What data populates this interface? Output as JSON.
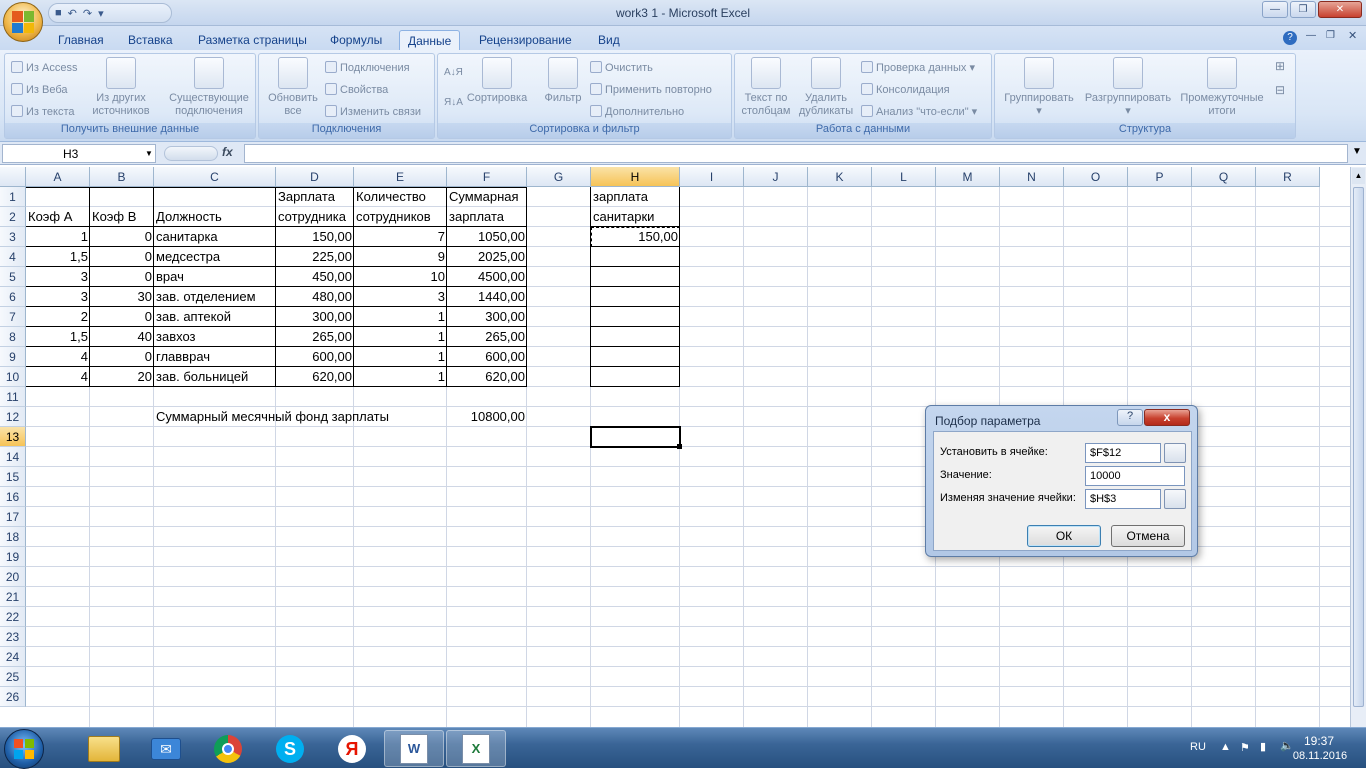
{
  "window": {
    "title": "work3 1 - Microsoft Excel"
  },
  "tabs": [
    "Главная",
    "Вставка",
    "Разметка страницы",
    "Формулы",
    "Данные",
    "Рецензирование",
    "Вид"
  ],
  "active_tab": "Данные",
  "ribbon": {
    "external": {
      "label": "Получить внешние данные",
      "access": "Из Access",
      "web": "Из Веба",
      "text": "Из текста",
      "other_1": "Из других",
      "other_2": "источников",
      "existing_1": "Существующие",
      "existing_2": "подключения"
    },
    "connections": {
      "label": "Подключения",
      "refresh_1": "Обновить",
      "refresh_2": "все",
      "conn": "Подключения",
      "props": "Свойства",
      "edit": "Изменить связи"
    },
    "sort": {
      "label": "Сортировка и фильтр",
      "sort": "Сортировка",
      "filter": "Фильтр",
      "clear": "Очистить",
      "reapply": "Применить повторно",
      "advanced": "Дополнительно"
    },
    "data_tools": {
      "label": "Работа с данными",
      "text_1": "Текст по",
      "text_2": "столбцам",
      "dup_1": "Удалить",
      "dup_2": "дубликаты",
      "validate": "Проверка данных",
      "consolidate": "Консолидация",
      "whatif": "Анализ \"что-если\""
    },
    "outline": {
      "label": "Структура",
      "group": "Группировать",
      "ungroup": "Разгруппировать",
      "sub_1": "Промежуточные",
      "sub_2": "итоги"
    }
  },
  "formula_bar": {
    "name_box": "H3",
    "fx": "fx",
    "formula": ""
  },
  "columns": [
    "A",
    "B",
    "C",
    "D",
    "E",
    "F",
    "G",
    "H",
    "I",
    "J",
    "K",
    "L",
    "M",
    "N",
    "O",
    "P",
    "Q",
    "R"
  ],
  "rows": [
    "1",
    "2",
    "3",
    "4",
    "5",
    "6",
    "7",
    "8",
    "9",
    "10",
    "11",
    "12",
    "13",
    "14",
    "15",
    "16",
    "17",
    "18",
    "19",
    "20",
    "21",
    "22",
    "23",
    "24",
    "25",
    "26"
  ],
  "headers": {
    "a": "Коэф А",
    "b": "Коэф В",
    "c": "Должность",
    "d1": "Зарплата",
    "d2": "сотрудника",
    "e1": "Количество",
    "e2": "сотрудников",
    "f1": "Суммарная",
    "f2": "зарплата",
    "h1": "зарплата",
    "h2": "санитарки"
  },
  "table": [
    [
      "1",
      "0",
      "санитарка",
      "150,00",
      "7",
      "1050,00"
    ],
    [
      "1,5",
      "0",
      "медсестра",
      "225,00",
      "9",
      "2025,00"
    ],
    [
      "3",
      "0",
      "врач",
      "450,00",
      "10",
      "4500,00"
    ],
    [
      "3",
      "30",
      "зав. отделением",
      "480,00",
      "3",
      "1440,00"
    ],
    [
      "2",
      "0",
      "зав. аптекой",
      "300,00",
      "1",
      "300,00"
    ],
    [
      "1,5",
      "40",
      "завхоз",
      "265,00",
      "1",
      "265,00"
    ],
    [
      "4",
      "0",
      "главврач",
      "600,00",
      "1",
      "600,00"
    ],
    [
      "4",
      "20",
      "зав. больницей",
      "620,00",
      "1",
      "620,00"
    ]
  ],
  "h3_value": "150,00",
  "summary": {
    "label": "Суммарный месячный фонд зарплаты",
    "value": "10800,00"
  },
  "dialog": {
    "title": "Подбор параметра",
    "set_cell_label": "Установить в ячейке:",
    "set_cell_value": "$F$12",
    "value_label": "Значение:",
    "value_value": "10000",
    "changing_label": "Изменяя значение ячейки:",
    "changing_value": "$H$3",
    "ok": "ОК",
    "cancel": "Отмена",
    "help": "?",
    "close": "x"
  },
  "tray": {
    "lang": "RU",
    "time": "19:37",
    "date": "08.11.2016"
  }
}
